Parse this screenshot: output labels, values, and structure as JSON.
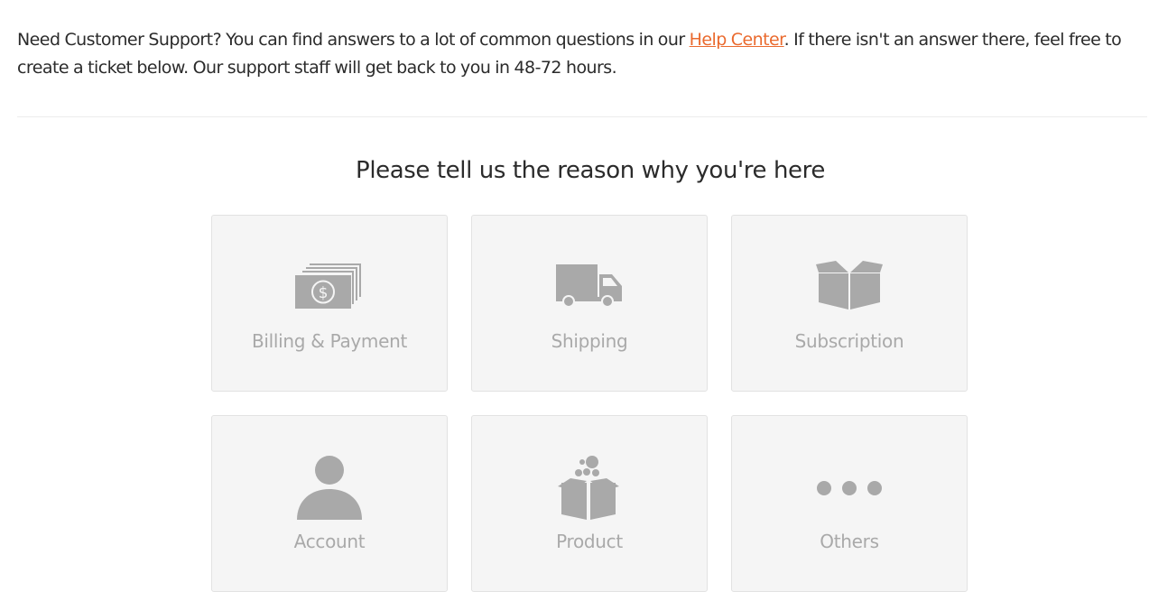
{
  "intro": {
    "text_before": "Need Customer Support? You can find answers to a lot of common questions in our ",
    "link_text": "Help Center",
    "text_after": ". If there isn't an answer there, feel free to create a ticket below. Our support staff will get back to you in 48-72 hours."
  },
  "heading": "Please tell us the reason why you're here",
  "cards": [
    {
      "label": "Billing & Payment",
      "icon": "money-icon"
    },
    {
      "label": "Shipping",
      "icon": "truck-icon"
    },
    {
      "label": "Subscription",
      "icon": "box-icon"
    },
    {
      "label": "Account",
      "icon": "user-icon"
    },
    {
      "label": "Product",
      "icon": "product-box-icon"
    },
    {
      "label": "Others",
      "icon": "more-icon"
    }
  ],
  "colors": {
    "accent_link": "#ea6a2e",
    "icon_gray": "#a9a9a9",
    "card_bg": "#f5f5f5"
  }
}
